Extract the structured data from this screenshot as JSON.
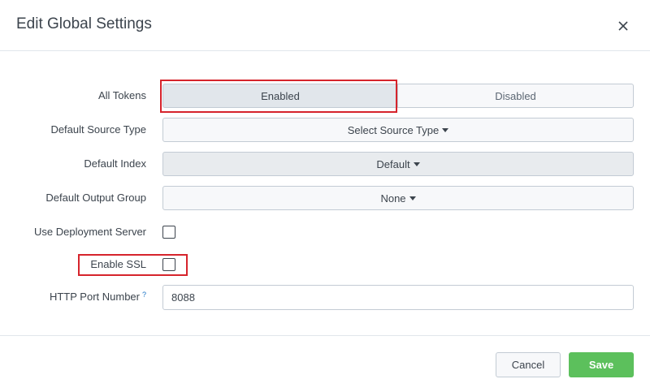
{
  "dialog": {
    "title": "Edit Global Settings"
  },
  "form": {
    "all_tokens": {
      "label": "All Tokens",
      "options": [
        "Enabled",
        "Disabled"
      ],
      "selected": "Enabled"
    },
    "default_source_type": {
      "label": "Default Source Type",
      "value": "Select Source Type"
    },
    "default_index": {
      "label": "Default Index",
      "value": "Default"
    },
    "default_output_group": {
      "label": "Default Output Group",
      "value": "None"
    },
    "use_deployment_server": {
      "label": "Use Deployment Server",
      "checked": false
    },
    "enable_ssl": {
      "label": "Enable SSL",
      "checked": false
    },
    "http_port": {
      "label": "HTTP Port Number",
      "help": "?",
      "value": "8088"
    }
  },
  "footer": {
    "cancel_label": "Cancel",
    "save_label": "Save"
  },
  "colors": {
    "highlight": "#d6242c",
    "save_button": "#5cc05c",
    "help_link": "#1a73c5"
  },
  "icons": {
    "close": "close-icon",
    "caret": "caret-down-icon"
  }
}
